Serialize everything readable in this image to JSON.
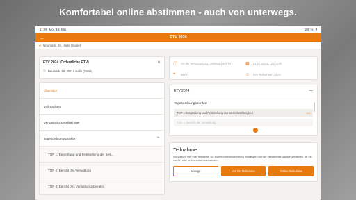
{
  "headline": "Komfortabel online abstimmen - auch von unterwegs.",
  "status": {
    "time": "11:09",
    "date": "Mo., 18. Mai",
    "battery": "100 %"
  },
  "appbar": {
    "title": "ETV 2024",
    "back_icon": "arrow-left-icon"
  },
  "location": {
    "text": "Neumarkt 59, Halle (Saale)"
  },
  "event_card": {
    "name": "ETV 2024 (Ordentliche ETV)",
    "address": "Neumarkt 59, 06110 Halle (Saale)"
  },
  "nav": {
    "items": [
      {
        "label": "Überblick",
        "active": true
      },
      {
        "label": "Vollmachten"
      },
      {
        "label": "Versammlungsteilnehmer"
      },
      {
        "label": "Tagesordnungspunkte",
        "chevron": "chevron-up-icon"
      }
    ],
    "sub_items": [
      {
        "label": "TOP 1: Begrüßung und Feststellung der Bes..."
      },
      {
        "label": "TOP 2: Bericht der Verwaltung"
      },
      {
        "label": "TOP 3: Bericht des Verwaltungsbeirates"
      }
    ]
  },
  "info": {
    "type": "Art der Versammlung: Ordentliche ETV",
    "datetime": "01.07.2024, 12:00 Uhr",
    "city": "Berlin",
    "participation": "Ihre Teilnahme: Offen"
  },
  "agenda": {
    "header": "ETV 2024",
    "collapse": "—",
    "subheader": "Tagesordnungspunkte",
    "items": [
      {
        "label": "TOP 1: Begrüßung und Feststellung der Beschlussfähigkeit",
        "badge": "0/4"
      },
      {
        "label": "TOP 2: Bericht der Verwaltung",
        "badge": ""
      }
    ]
  },
  "vote": {
    "title": "Teilnahme",
    "description": "Sie können hier Ihre Teilnahme zur Eigentümerversammlung bestätigen und der Versammlungsleitung mitteilen, ob Sie vor Ort oder online teilnehmen werden.",
    "buttons": {
      "decline": "Absage",
      "onsite": "Vor Ort Teilnahme",
      "online": "Online Teilnahme"
    }
  },
  "colors": {
    "accent": "#e8790f"
  }
}
